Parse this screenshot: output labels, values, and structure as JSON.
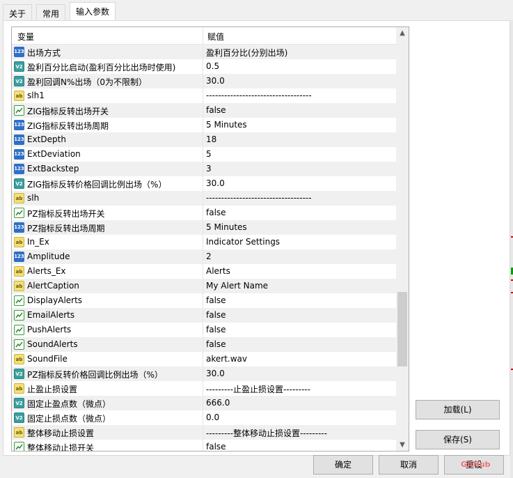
{
  "tabs": [
    "关于",
    "常用",
    "输入参数"
  ],
  "table": {
    "header_var": "变量",
    "header_val": "赋值",
    "rows": [
      {
        "type": "num",
        "icon_text": "123",
        "name": "出场方式",
        "value": "盈利百分比(分别出场)"
      },
      {
        "type": "dbl",
        "icon_text": "V2",
        "name": "盈利百分比启动(盈利百分比出场时使用)",
        "value": "0.5"
      },
      {
        "type": "dbl",
        "icon_text": "V2",
        "name": "盈利回调N%出场（0为不限制）",
        "value": "30.0"
      },
      {
        "type": "str",
        "icon_text": "ab",
        "name": "slh1",
        "value": "-----------------------------------"
      },
      {
        "type": "bool",
        "icon_text": "",
        "name": "ZIG指标反转出场开关",
        "value": "false"
      },
      {
        "type": "num",
        "icon_text": "123",
        "name": "ZIG指标反转出场周期",
        "value": "5 Minutes"
      },
      {
        "type": "num",
        "icon_text": "123",
        "name": "ExtDepth",
        "value": "18"
      },
      {
        "type": "num",
        "icon_text": "123",
        "name": "ExtDeviation",
        "value": "5"
      },
      {
        "type": "num",
        "icon_text": "123",
        "name": "ExtBackstep",
        "value": "3"
      },
      {
        "type": "dbl",
        "icon_text": "V2",
        "name": "ZIG指标反转价格回调比例出场（%）",
        "value": "30.0"
      },
      {
        "type": "str",
        "icon_text": "ab",
        "name": "slh",
        "value": "-----------------------------------"
      },
      {
        "type": "bool",
        "icon_text": "",
        "name": "PZ指标反转出场开关",
        "value": "false"
      },
      {
        "type": "num",
        "icon_text": "123",
        "name": "PZ指标反转出场周期",
        "value": "5 Minutes"
      },
      {
        "type": "str",
        "icon_text": "ab",
        "name": "In_Ex",
        "value": "Indicator Settings"
      },
      {
        "type": "num",
        "icon_text": "123",
        "name": "Amplitude",
        "value": "2"
      },
      {
        "type": "str",
        "icon_text": "ab",
        "name": "Alerts_Ex",
        "value": "Alerts"
      },
      {
        "type": "str",
        "icon_text": "ab",
        "name": "AlertCaption",
        "value": "My Alert Name"
      },
      {
        "type": "bool",
        "icon_text": "",
        "name": "DisplayAlerts",
        "value": "false"
      },
      {
        "type": "bool",
        "icon_text": "",
        "name": "EmailAlerts",
        "value": "false"
      },
      {
        "type": "bool",
        "icon_text": "",
        "name": "PushAlerts",
        "value": "false"
      },
      {
        "type": "bool",
        "icon_text": "",
        "name": "SoundAlerts",
        "value": "false"
      },
      {
        "type": "str",
        "icon_text": "ab",
        "name": "SoundFile",
        "value": "akert.wav"
      },
      {
        "type": "dbl",
        "icon_text": "V2",
        "name": "PZ指标反转价格回调比例出场（%）",
        "value": "30.0"
      },
      {
        "type": "str",
        "icon_text": "ab",
        "name": "止盈止损设置",
        "value": "---------止盈止损设置---------"
      },
      {
        "type": "dbl",
        "icon_text": "V2",
        "name": "固定止盈点数（微点）",
        "value": "666.0"
      },
      {
        "type": "dbl",
        "icon_text": "V2",
        "name": "固定止损点数（微点）",
        "value": "0.0"
      },
      {
        "type": "str",
        "icon_text": "ab",
        "name": "整体移动止损设置",
        "value": "---------整体移动止损设置---------"
      },
      {
        "type": "bool",
        "icon_text": "",
        "name": "整体移动止损开关",
        "value": "false"
      }
    ]
  },
  "buttons": {
    "load": "加载(L)",
    "save": "保存(S)",
    "ok": "确定",
    "cancel": "取消",
    "reset": "重设"
  },
  "watermark": "GAHub",
  "colors": {
    "accent_red": "#d00000",
    "accent_green": "#00a000"
  }
}
